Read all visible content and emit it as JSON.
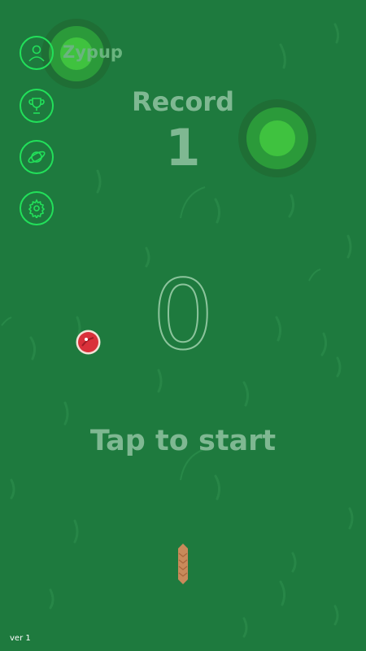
{
  "profile": {
    "username": "Zypup",
    "icon": "user-icon"
  },
  "menu": [
    {
      "name": "profile",
      "icon": "user-icon"
    },
    {
      "name": "leaderboard",
      "icon": "trophy-icon"
    },
    {
      "name": "worlds",
      "icon": "planet-icon"
    },
    {
      "name": "settings",
      "icon": "gear-icon"
    }
  ],
  "record": {
    "label": "Record",
    "value": "1"
  },
  "score": "0",
  "start_prompt": "Tap to start",
  "version": "ver 1",
  "colors": {
    "background": "#1e7a3e",
    "accent": "#22e05a",
    "text": "#7fb892"
  }
}
